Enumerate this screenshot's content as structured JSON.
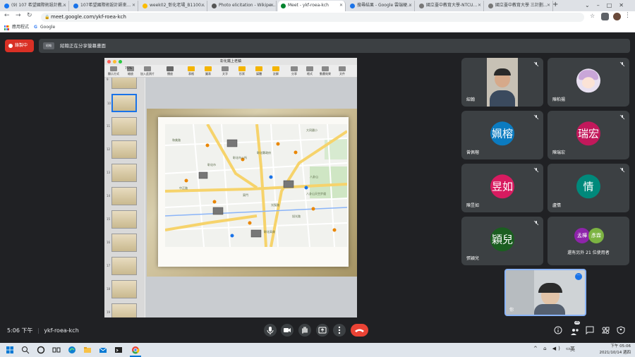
{
  "browser": {
    "tabs": [
      {
        "label": "(9) 107 希望國際術設計教...",
        "color": "#1877f2"
      },
      {
        "label": "107希望國際術設計師來...",
        "color": "#1a73e8"
      },
      {
        "label": "week02_彰化老場_B1100...",
        "color": "#fbbc04"
      },
      {
        "label": "Photo elicitation - Wikipe...",
        "color": "#555555"
      },
      {
        "label": "Meet - ykf-roea-kch",
        "color": "#00832d"
      },
      {
        "label": "搜尋結果 - Google 雲端硬...",
        "color": "#1a73e8"
      },
      {
        "label": "國立臺中教育大學-NTCU...",
        "color": "#777777"
      },
      {
        "label": "國立臺中教育大學 三計劃...",
        "color": "#777777"
      }
    ],
    "url": "meet.google.com/ykf-roea-kch",
    "bookmarks": [
      "應用程式",
      "Google"
    ]
  },
  "meet": {
    "recording_label": "錄製中",
    "presenter_chip": "紹翰",
    "presenting_text": "紹翰正在分享螢幕畫面",
    "time": "5:06 下午",
    "meeting_code": "ykf-roea-kch",
    "badge_count": "30",
    "self_name": "你",
    "participants": [
      {
        "name": "紹翰",
        "avatar": "",
        "color": "#3c4043",
        "video": true
      },
      {
        "name": "陳柏揚",
        "avatar": "",
        "color": "#3c4043",
        "cartoon": true
      },
      {
        "name": "曾佩榕",
        "avatar": "姵榕",
        "color": "#0b7bc0"
      },
      {
        "name": "陳瑞宏",
        "avatar": "瑞宏",
        "color": "#c2185b"
      },
      {
        "name": "陳昱如",
        "avatar": "昱如",
        "color": "#d81b60"
      },
      {
        "name": "盧情",
        "avatar": "情",
        "color": "#00897b"
      },
      {
        "name": "張穎兒",
        "avatar": "穎兒",
        "color": "#1b5e20"
      },
      {
        "name": "還有另外 21 位使用者",
        "avatar": "孟樺",
        "avatar2": "彥霖",
        "color": "#8e24aa",
        "color2": "#7cb342"
      }
    ]
  },
  "keynote": {
    "title": "彰化鐵上老鎮",
    "toolbar": [
      "顯示方式",
      "縮放",
      "加入此頁片",
      "播放",
      "表格",
      "圖表",
      "文字",
      "形狀",
      "媒體",
      "註解",
      "分享",
      "格式",
      "動畫效果",
      "文件"
    ],
    "zoom": "75%",
    "thumb_numbers": [
      "9",
      "10",
      "11",
      "12",
      "13",
      "14",
      "15",
      "16",
      "17",
      "18",
      "19"
    ]
  },
  "map": {
    "labels": [
      "大同國小",
      "彰化市",
      "八卦山",
      "八卦山天空步道",
      "彰化縣政府",
      "彰化市公所",
      "中正路",
      "光復路",
      "和美路",
      "旭光路",
      "彰化高商",
      "東門"
    ]
  },
  "taskbar": {
    "tray_lang": "英",
    "time": "下午 05:06",
    "date": "2021/10/14 週四"
  }
}
